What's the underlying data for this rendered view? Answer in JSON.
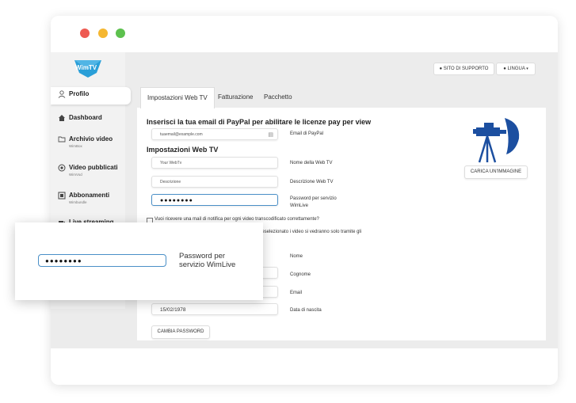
{
  "window": {
    "controls": [
      "close",
      "minimize",
      "maximize"
    ]
  },
  "brand": {
    "logo_text": "WimTV",
    "logo_color": "#2a9fd8"
  },
  "header": {
    "support_button": "SITO DI SUPPORTO",
    "language_button": "LINGUA"
  },
  "sidebar": {
    "items": [
      {
        "label": "Profilo",
        "sub": "",
        "icon": "user-icon"
      },
      {
        "label": "Dashboard",
        "sub": "",
        "icon": "home-icon"
      },
      {
        "label": "Archivio video",
        "sub": "WimBox",
        "icon": "folder-icon"
      },
      {
        "label": "Video pubblicati",
        "sub": "WimVod",
        "icon": "play-circle-icon"
      },
      {
        "label": "Abbonamenti",
        "sub": "Wimbundle",
        "icon": "film-icon"
      },
      {
        "label": "Live streaming",
        "sub": "",
        "icon": "camera-icon"
      }
    ]
  },
  "tabs": [
    "Impostazioni Web TV",
    "Fatturazione",
    "Pacchetto"
  ],
  "form": {
    "paypal_heading": "Inserisci la tua email di PayPal per abilitare le licenze pay per view",
    "paypal_value": "tuaemail@example.com",
    "paypal_label": "Email di PayPal",
    "webtv_heading": "Impostazioni Web TV",
    "webtv_name_value": "Your WebTv",
    "webtv_name_label": "Nome della Web TV",
    "webtv_desc_value": "Descrizione",
    "webtv_desc_label": "Descrizione Web TV",
    "password_value": "●●●●●●●●",
    "password_label_1": "Password per servizio",
    "password_label_2": "WimLive",
    "upload_button": "CARICA UN'IMMAGINE",
    "notify_checkbox": "Vuoi ricevere una mail di notifica per ogni video transcodificato correttamente?",
    "public_partial": "se deselezionato i video si vedranno solo tramite gli",
    "nome_label": "Nome",
    "cognome_label": "Cognome",
    "email_label": "Email",
    "birth_value": "15/02/1978",
    "birth_label": "Data di nascita",
    "change_password_button": "CAMBIA PASSWORD"
  },
  "overlay": {
    "password_value": "●●●●●●●●",
    "label": "Password per servizio WimLive"
  },
  "colors": {
    "accent_focus": "#4a8fc7",
    "camera_blue": "#1c4fa0"
  }
}
